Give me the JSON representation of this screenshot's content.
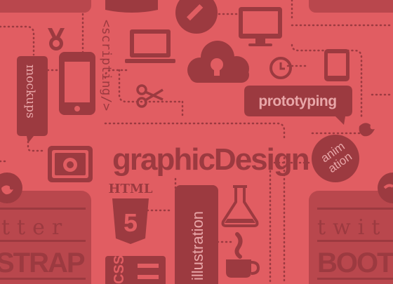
{
  "colors": {
    "background": "#e15d62",
    "ink": "#9c3a40",
    "ink_light": "#b9474d",
    "ink_text_on_badge": "#e8a6a8"
  },
  "labels": {
    "scripting": "<scripting/>",
    "mockups": "mockups",
    "prototyping": "prototyping",
    "graphic_design": "graphicDesign",
    "animation_line1": "anim",
    "animation_line2": "ation",
    "html": "HTML",
    "html_number": "5",
    "illustration": "illustration",
    "twitter_left": "tter",
    "bootstrap_left": "STRAP",
    "twitter_right": "twit",
    "bootstrap_right": "BOOTS",
    "css": "CSS"
  },
  "icons": [
    "medal-icon",
    "smartphone-icon",
    "laptop-icon",
    "cloud-bulb-icon",
    "scissors-icon",
    "monitor-icon",
    "clock-icon",
    "tablet-icon",
    "pencil-icon",
    "camera-icon",
    "flask-icon",
    "coffee-cup-icon",
    "bird-icon",
    "css3-shield-icon",
    "html5-shield-icon"
  ]
}
